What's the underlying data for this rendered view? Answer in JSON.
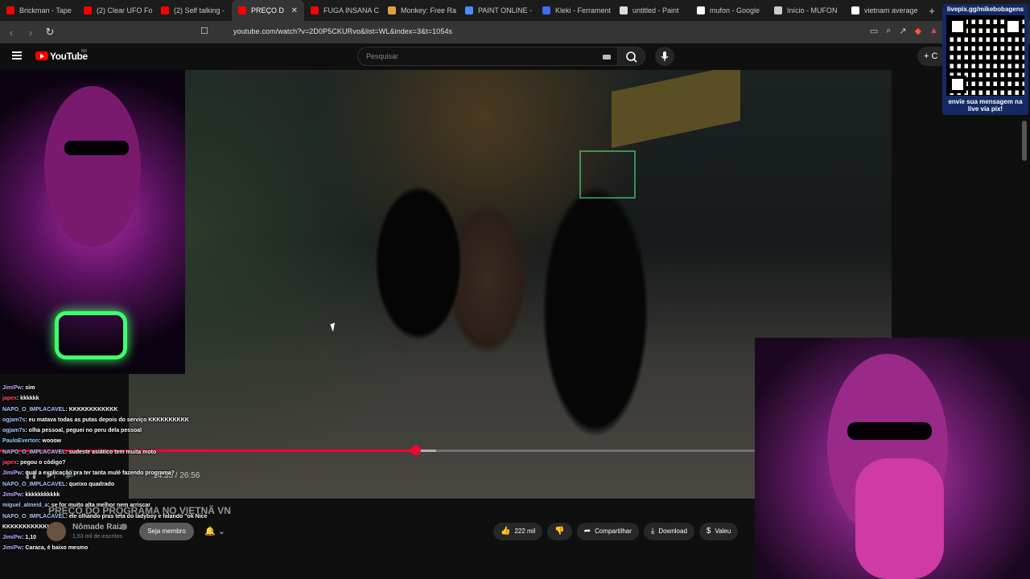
{
  "browser": {
    "tabs": [
      {
        "label": "Brickman - Tape",
        "color": "#ff0000"
      },
      {
        "label": "(2) Clear UFO Fo",
        "color": "#ff0000"
      },
      {
        "label": "(2) Self talking -",
        "color": "#ff0000"
      },
      {
        "label": "PREÇO D",
        "color": "#ff0000",
        "active": true
      },
      {
        "label": "FUGA INSANA C",
        "color": "#ff0000"
      },
      {
        "label": "Monkey: Free Ra",
        "color": "#e0a040"
      },
      {
        "label": "PAINT ONLINE -",
        "color": "#4a8cff"
      },
      {
        "label": "Kleki - Ferrament",
        "color": "#3a6cff"
      },
      {
        "label": "untitled - Paint",
        "color": "#dddddd"
      },
      {
        "label": "mufon - Google",
        "color": "#ffffff"
      },
      {
        "label": "Início - MUFON",
        "color": "#cccccc"
      },
      {
        "label": "vietnam average",
        "color": "#ffffff"
      }
    ],
    "url": "youtube.com/watch?v=2D0P5CKURvo&list=WL&index=3&t=1054s"
  },
  "youtube": {
    "logo_text": "YouTube",
    "country": "BR",
    "search_placeholder": "Pesquisar",
    "create_label": "C"
  },
  "overlay": {
    "qr_top": "livepix.gg/mikebobagens",
    "qr_bottom": "envie sua mensagem na live via pix!"
  },
  "player": {
    "progress_fraction": 0.551,
    "buffer_fraction": 0.578,
    "time": "14:35 / 26:56",
    "title_overlay": "PREÇO DO PROGRAMA NO VIETNÃ VN"
  },
  "chat": [
    {
      "user": "JimiPw",
      "text": ": sim"
    },
    {
      "user": "japex",
      "text": ": kkkkkk"
    },
    {
      "user": "NAPO_O_IMPLACAVEL",
      "text": ": KKKKKKKKKKKK"
    },
    {
      "user": "ogjam7s",
      "text": ": eu matava todas as putas depois do serviço KKKKKKKKKK"
    },
    {
      "user": "ogjam7s",
      "text": ": olha pessoal, peguei no peru dela pessoal"
    },
    {
      "user": "PauloEverton",
      "text": ": wooow"
    },
    {
      "user": "NAPO_O_IMPLACAVEL",
      "text": ": sudeste asiático tem muita moto"
    },
    {
      "user": "japex",
      "text": ": pegou o código?"
    },
    {
      "user": "JimiPw",
      "text": ": qual a explicação pra ter tanta mulé fazendo programa?"
    },
    {
      "user": "NAPO_O_IMPLACAVEL",
      "text": ": queixo quadrado"
    },
    {
      "user": "JimiPw",
      "text": ": kkkkkkkkkkk"
    },
    {
      "user": "miguel_almeid_a",
      "text": ": se for muito alta melhor nem arriscar"
    },
    {
      "user": "NAPO_O_IMPLACAVEL",
      "text": ": ele olhando pras teta do ladyboy e falando \"ok Nice"
    },
    {
      "user": "",
      "text": "KKKKKKKKKKKKK"
    },
    {
      "user": "JimiPw",
      "text": ": 1,10"
    },
    {
      "user": "JimiPw",
      "text": ": Caraca, é baixo mesmo"
    }
  ],
  "channel": {
    "name": "Nômade Raiz",
    "subscribers": "1,63 mil de inscritos",
    "member_label": "Seja membro"
  },
  "actions": {
    "likes": "222 mil",
    "share": "Compartilhar",
    "download": "Download",
    "thanks": "Valeu"
  }
}
